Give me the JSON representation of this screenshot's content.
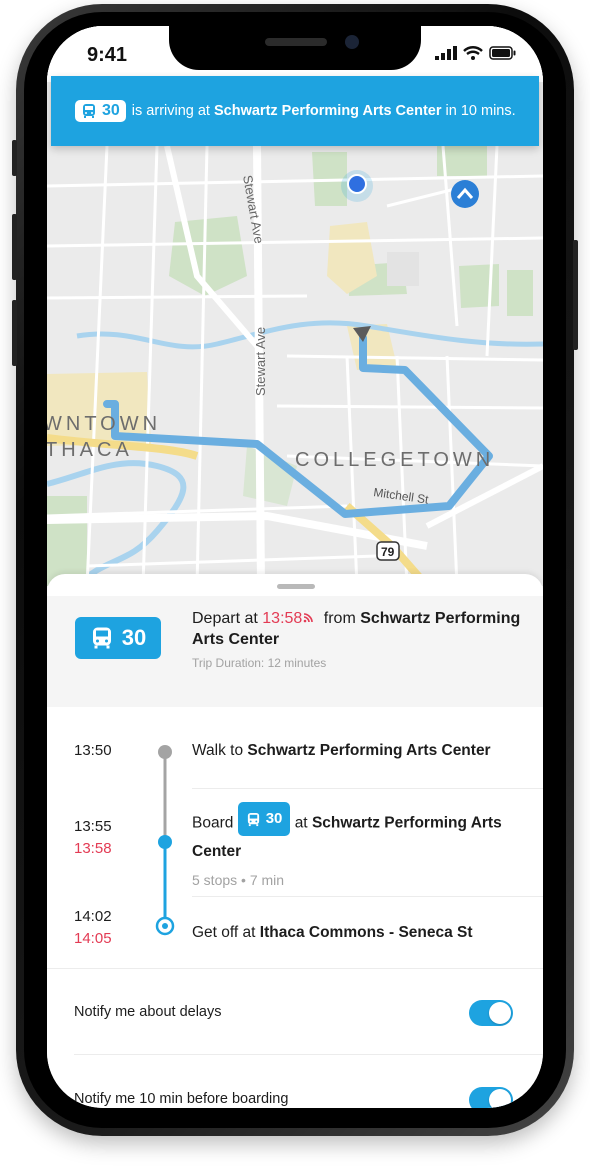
{
  "status_bar": {
    "time": "9:41"
  },
  "banner": {
    "route": "30",
    "prefix": "is arriving at",
    "stop": "Schwartz Performing Arts Center",
    "suffix": "in 10 mins."
  },
  "map": {
    "labels": {
      "stewart_ave_1": "Stewart Ave",
      "stewart_ave_2": "Stewart Ave",
      "downtown_1": "WNTOWN",
      "downtown_2": "THACA",
      "collegetown": "COLLEGETOWN",
      "mitchell": "Mitchell St",
      "route_79": "79"
    }
  },
  "trip": {
    "route": "30",
    "depart_prefix": "Depart at",
    "depart_time": "13:58",
    "from_label": "from",
    "from_stop": "Schwartz Performing Arts Center",
    "duration": "Trip Duration: 12 minutes"
  },
  "steps": [
    {
      "time": "13:50",
      "label_prefix": "Walk to",
      "label_bold": "Schwartz Performing Arts Center"
    },
    {
      "time": "13:55",
      "time_realtime": "13:58",
      "label_prefix": "Board",
      "route": "30",
      "label_mid": "at",
      "label_bold": "Schwartz Performing Arts Center",
      "detail": "5 stops • 7 min"
    },
    {
      "time": "14:02",
      "time_realtime": "14:05",
      "label_prefix": "Get off at",
      "label_bold": "Ithaca Commons - Seneca St"
    }
  ],
  "settings": [
    {
      "label": "Notify me about delays",
      "enabled": true
    },
    {
      "label": "Notify me 10 min before boarding",
      "enabled": true
    }
  ],
  "colors": {
    "accent": "#1ea3e0",
    "realtime": "#e33b54",
    "walk_line": "#a4a4a4"
  }
}
